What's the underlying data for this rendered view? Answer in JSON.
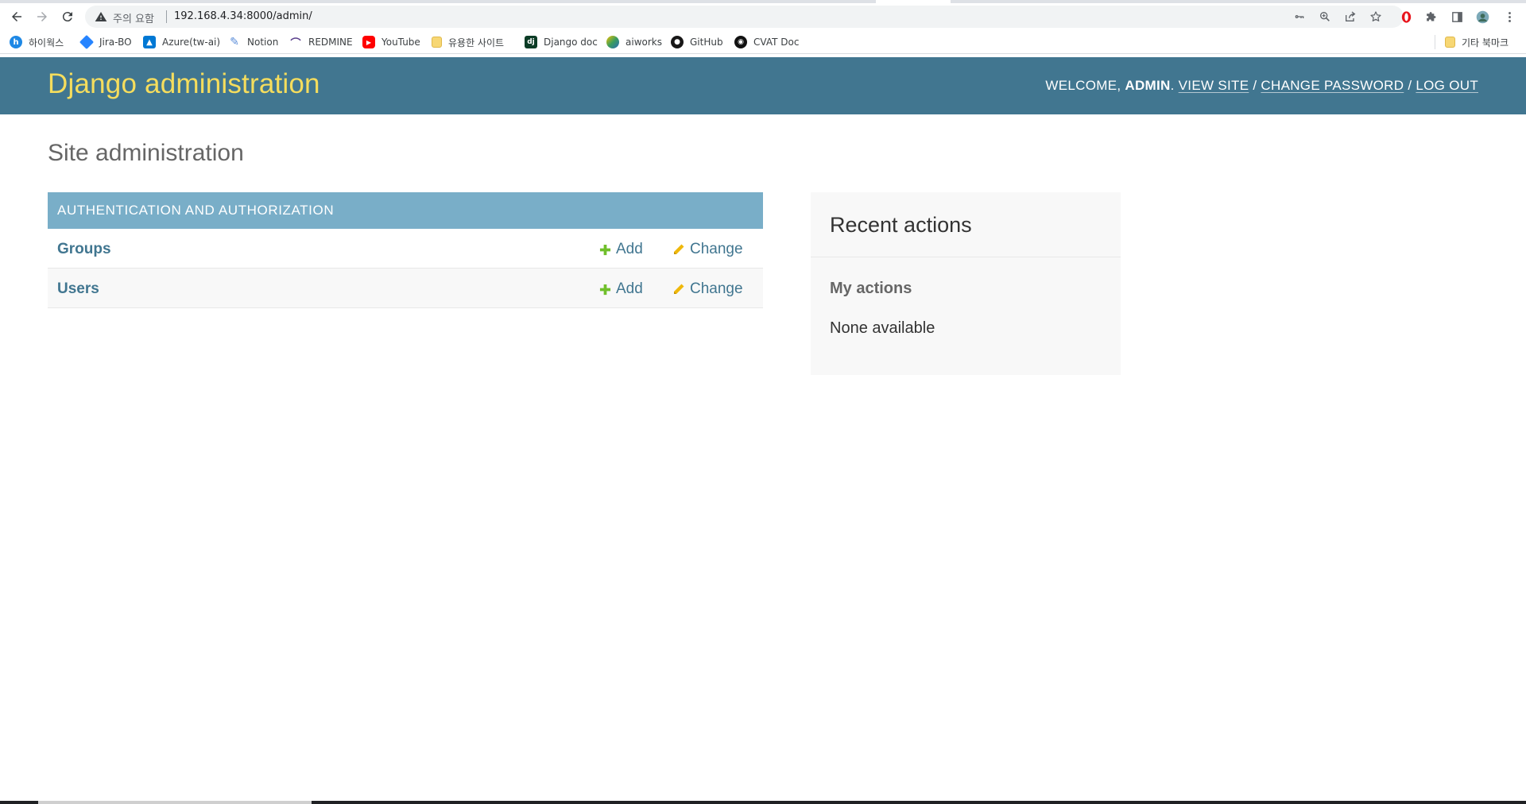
{
  "browser": {
    "security_warning": "주의 요함",
    "url": "192.168.4.34:8000/admin/",
    "bookmarks": [
      {
        "label": "하이웍스",
        "icon": "hiworks-icon"
      },
      {
        "label": "Jira-BO",
        "icon": "jira-icon"
      },
      {
        "label": "Azure(tw-ai)",
        "icon": "azure-icon"
      },
      {
        "label": "Notion",
        "icon": "feather-icon"
      },
      {
        "label": "REDMINE",
        "icon": "redmine-icon"
      },
      {
        "label": "YouTube",
        "icon": "youtube-icon"
      },
      {
        "label": "유용한 사이트",
        "icon": "folder-icon"
      },
      {
        "label": "Django doc",
        "icon": "django-icon"
      },
      {
        "label": "aiworks",
        "icon": "aiworks-icon"
      },
      {
        "label": "GitHub",
        "icon": "github-icon"
      },
      {
        "label": "CVAT Doc",
        "icon": "cvat-icon"
      }
    ],
    "other_bookmarks": "기타 북마크"
  },
  "header": {
    "branding": "Django administration",
    "welcome": "Welcome,",
    "username": "admin",
    "view_site": "View site",
    "change_password": "Change password",
    "log_out": "Log out"
  },
  "content": {
    "title": "Site administration",
    "module": {
      "caption": "Authentication and Authorization",
      "models": [
        {
          "name": "Groups",
          "add": "Add",
          "change": "Change"
        },
        {
          "name": "Users",
          "add": "Add",
          "change": "Change"
        }
      ]
    },
    "recent": {
      "title": "Recent actions",
      "subtitle": "My actions",
      "empty": "None available"
    }
  },
  "colors": {
    "header_bg": "#417690",
    "branding": "#f5dd5d",
    "caption_bg": "#79aec8",
    "link": "#417690",
    "add_icon": "#70bf2b",
    "change_icon": "#efb80b"
  }
}
